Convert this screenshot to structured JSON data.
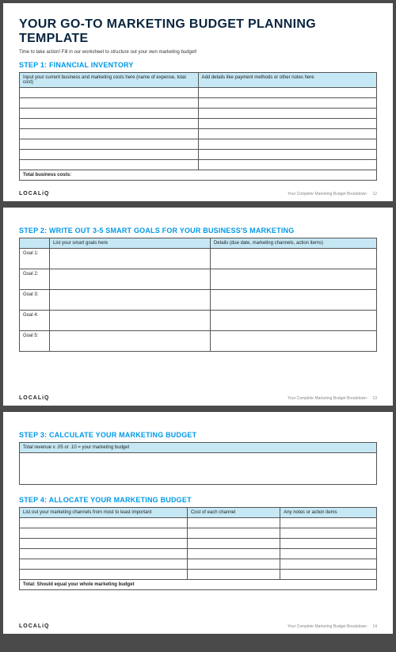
{
  "doc": {
    "title": "YOUR GO-TO MARKETING BUDGET PLANNING TEMPLATE",
    "subtitle": "Time to take action! Fill in our worksheet to structure out your own marketing budget!",
    "brand": "LOCALiQ",
    "footer_text": "Your Complete Marketing Budget Breakdown"
  },
  "step1": {
    "heading": "STEP 1: FINANCIAL INVENTORY",
    "col1": "Input your current business and marketing costs here (name of expense, total cost)",
    "col2": "Add details like payment methods or other notes here",
    "total_label": "Total business costs:",
    "page": "12"
  },
  "step2": {
    "heading": "STEP 2: WRITE OUT 3-5 SMART GOALS FOR YOUR BUSINESS'S MARKETING",
    "col1": "List your smart goals here",
    "col2": "Details (due date, marketing channels, action items)",
    "goals": [
      "Goal 1:",
      "Goal 2:",
      "Goal 3:",
      "Goal 4:",
      "Goal 5:"
    ],
    "page": "13"
  },
  "step3": {
    "heading": "STEP 3: CALCULATE YOUR MARKETING BUDGET",
    "formula": "Total revenue x .05 or .10 = your marketing budget"
  },
  "step4": {
    "heading": "STEP 4: ALLOCATE YOUR MARKETING BUDGET",
    "col1": "List out your marketing channels from most to least important",
    "col2": "Cost of each channel",
    "col3": "Any notes or action items",
    "total_label": "Total: Should equal your whole marketing budget",
    "page": "14"
  }
}
